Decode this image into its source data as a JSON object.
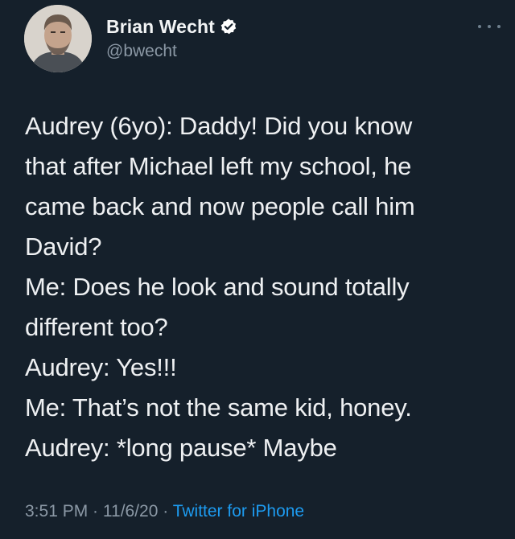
{
  "author": {
    "display_name": "Brian Wecht",
    "handle": "@bwecht",
    "verified": true,
    "avatar_icon": "person-photo-avatar"
  },
  "tweet": {
    "lines": [
      "Audrey (6yo): Daddy! Did you know",
      "that after Michael left my school, he",
      "came back and now people call him",
      "David?",
      "Me: Does he look and sound totally",
      "different too?",
      "Audrey: Yes!!!",
      "Me: That’s not the same kid, honey.",
      "Audrey: *long pause* Maybe"
    ]
  },
  "meta": {
    "time": "3:51 PM",
    "separator": " · ",
    "date": "11/6/20",
    "source": "Twitter for iPhone"
  },
  "colors": {
    "background": "#15202b",
    "text": "#eef0f2",
    "secondary": "#8b98a5",
    "link": "#1d9bf0",
    "verified_badge": "#ffffff"
  }
}
